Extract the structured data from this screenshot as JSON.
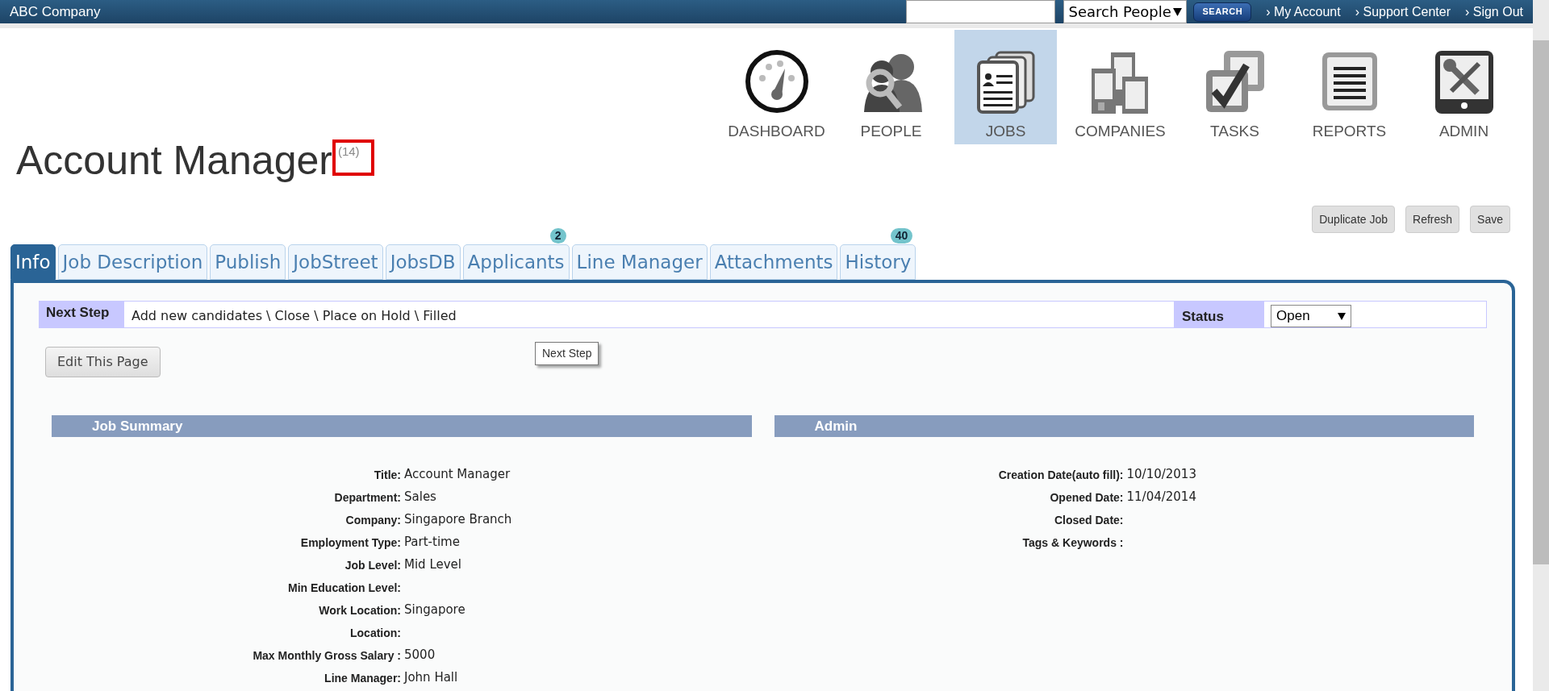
{
  "header": {
    "brand": "ABC Company",
    "search_select": "Search People",
    "search_button": "SEARCH",
    "links": [
      "› My Account",
      "› Support Center",
      "› Sign Out"
    ]
  },
  "nav": [
    {
      "label": "DASHBOARD",
      "kind": "dashboard",
      "selected": false
    },
    {
      "label": "PEOPLE",
      "kind": "people",
      "selected": false
    },
    {
      "label": "JOBS",
      "kind": "jobs",
      "selected": true
    },
    {
      "label": "COMPANIES",
      "kind": "companies",
      "selected": false
    },
    {
      "label": "TASKS",
      "kind": "tasks",
      "selected": false
    },
    {
      "label": "REPORTS",
      "kind": "reports",
      "selected": false
    },
    {
      "label": "ADMIN",
      "kind": "admin",
      "selected": false
    }
  ],
  "title": "Account Manager",
  "count": "(14)",
  "count_highlighted": true,
  "actions": [
    "Duplicate Job",
    "Refresh",
    "Save"
  ],
  "tabs": [
    {
      "label": "Info",
      "selected": true
    },
    {
      "label": "Job Description",
      "selected": false
    },
    {
      "label": "Publish",
      "selected": false
    },
    {
      "label": "JobStreet",
      "selected": false
    },
    {
      "label": "JobsDB",
      "selected": false
    },
    {
      "label": "Applicants",
      "selected": false,
      "badge": "2"
    },
    {
      "label": "Line Manager",
      "selected": false
    },
    {
      "label": "Attachments",
      "selected": false
    },
    {
      "label": "History",
      "selected": false,
      "badge": "40"
    }
  ],
  "next_step": {
    "label": "Next Step",
    "text": "Add new candidates \\ Close \\ Place on Hold \\ Filled",
    "status_label": "Status",
    "status_value": "Open"
  },
  "tooltip": "Next Step",
  "edit_button": "Edit This Page",
  "sections": [
    {
      "title": "Job Summary",
      "fields": [
        {
          "label": "Title:",
          "value": "Account Manager"
        },
        {
          "label": "Department:",
          "value": "Sales"
        },
        {
          "label": "Company:",
          "value": "Singapore Branch"
        },
        {
          "label": "Employment Type:",
          "value": "Part-time"
        },
        {
          "label": "Job Level:",
          "value": "Mid Level"
        },
        {
          "label": "Min Education Level:"
        },
        {
          "label": "Work Location:",
          "value": "Singapore"
        },
        {
          "label": "Location:"
        },
        {
          "label": "Max Monthly Gross Salary :",
          "value": "5000"
        },
        {
          "label": "Line Manager:",
          "value": "John Hall"
        }
      ]
    },
    {
      "title": "Admin",
      "fields": [
        {
          "label": "Creation Date(auto fill):",
          "value": "10/10/2013"
        },
        {
          "label": "Opened Date:",
          "value": "11/04/2014"
        },
        {
          "label": "Closed Date:"
        },
        {
          "label": "Tags & Keywords :"
        }
      ]
    }
  ]
}
